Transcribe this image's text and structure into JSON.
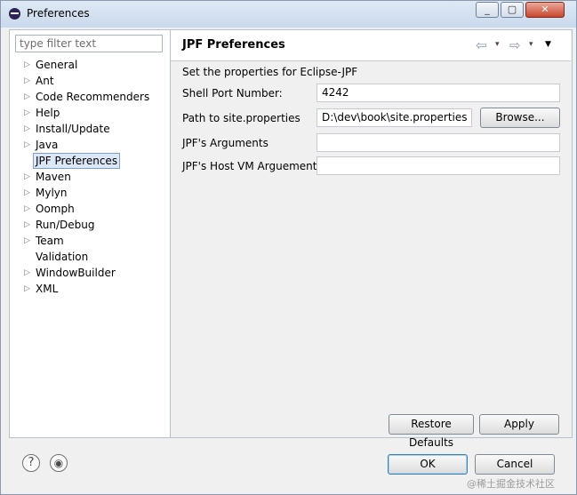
{
  "window": {
    "title": "Preferences",
    "minimize_glyph": "_",
    "maximize_glyph": "▢",
    "close_glyph": "✕"
  },
  "filter": {
    "placeholder": "type filter text",
    "value": ""
  },
  "tree": {
    "items": [
      {
        "label": "General",
        "expandable": true
      },
      {
        "label": "Ant",
        "expandable": true
      },
      {
        "label": "Code Recommenders",
        "expandable": true
      },
      {
        "label": "Help",
        "expandable": true
      },
      {
        "label": "Install/Update",
        "expandable": true
      },
      {
        "label": "Java",
        "expandable": true
      },
      {
        "label": "JPF Preferences",
        "expandable": false,
        "selected": true
      },
      {
        "label": "Maven",
        "expandable": true
      },
      {
        "label": "Mylyn",
        "expandable": true
      },
      {
        "label": "Oomph",
        "expandable": true
      },
      {
        "label": "Run/Debug",
        "expandable": true
      },
      {
        "label": "Team",
        "expandable": true
      },
      {
        "label": "Validation",
        "expandable": false
      },
      {
        "label": "WindowBuilder",
        "expandable": true
      },
      {
        "label": "XML",
        "expandable": true
      }
    ],
    "arrow_glyph": "▷"
  },
  "page": {
    "title": "JPF Preferences",
    "nav": {
      "back_glyph": "⇦",
      "forward_glyph": "⇨",
      "dropdown_glyph": "▾",
      "menu_glyph": "▼"
    },
    "description": "Set the properties for Eclipse-JPF",
    "fields": {
      "shell_port": {
        "label": "Shell Port Number:",
        "value": "4242"
      },
      "site_properties": {
        "label": "Path to site.properties",
        "value": "D:\\dev\\book\\site.properties"
      },
      "jpf_arguments": {
        "label": "JPF's Arguments",
        "value": ""
      },
      "host_vm_arguments": {
        "label": "JPF's Host VM Arguements",
        "value": ""
      }
    },
    "browse_label": "Browse...",
    "restore_defaults_label": "Restore Defaults",
    "apply_label": "Apply"
  },
  "footer": {
    "help_glyph": "?",
    "import_export_glyph": "◉",
    "ok_label": "OK",
    "cancel_label": "Cancel"
  },
  "watermark": "@稀土掘金技术社区"
}
